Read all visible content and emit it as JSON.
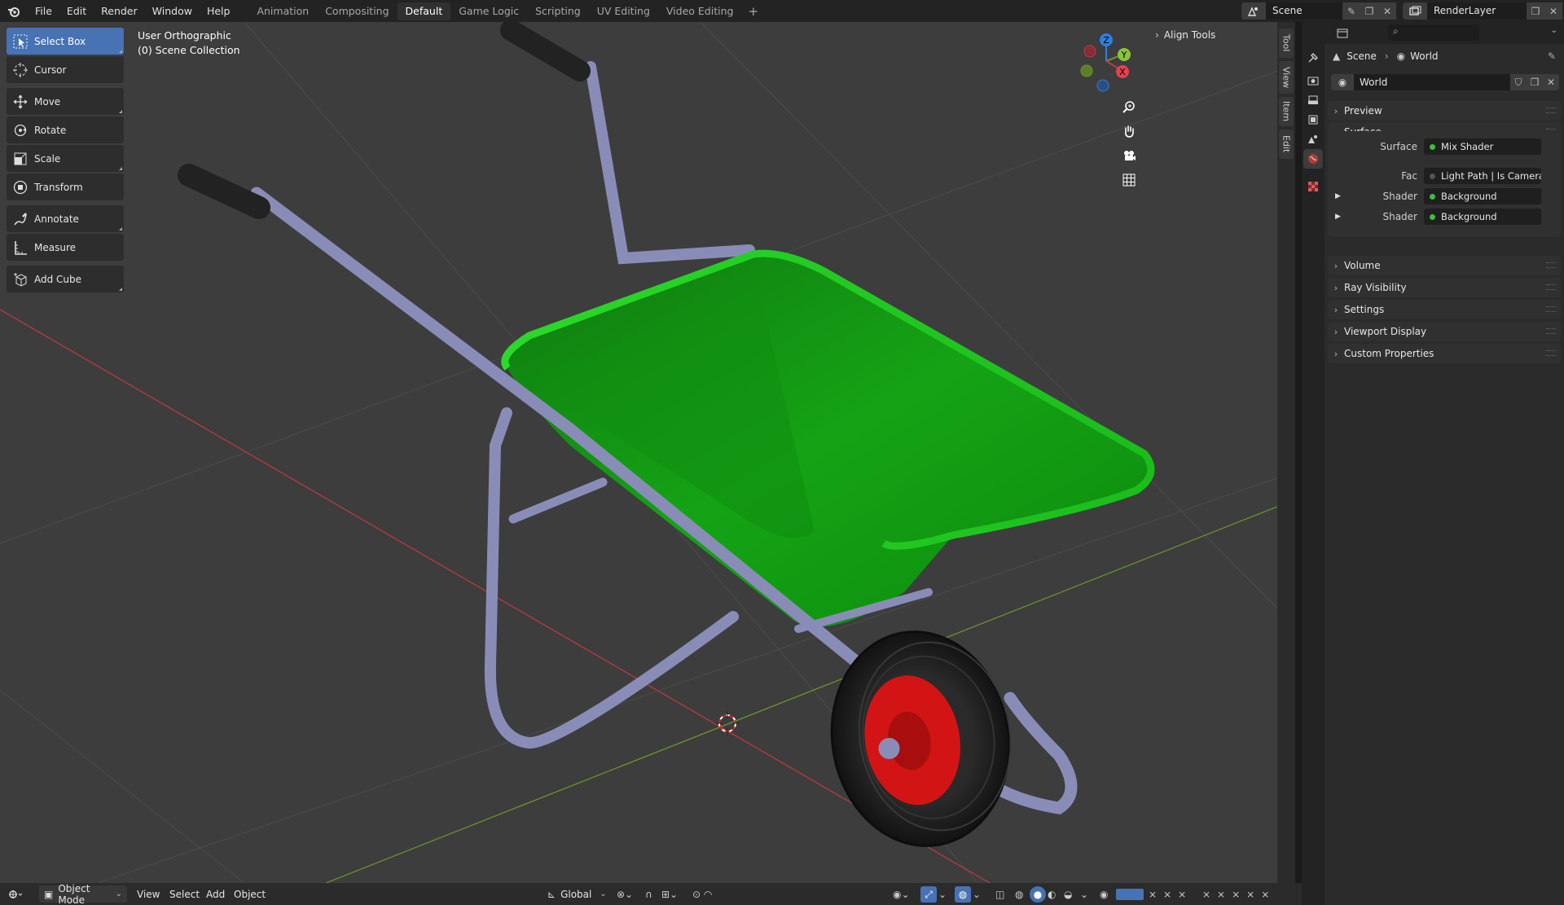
{
  "topbar": {
    "menus": [
      "File",
      "Edit",
      "Render",
      "Window",
      "Help"
    ],
    "workspaces": [
      "Animation",
      "Compositing",
      "Default",
      "Game Logic",
      "Scripting",
      "UV Editing",
      "Video Editing"
    ],
    "active_workspace": "Default",
    "add_tab": "+",
    "scene": "Scene",
    "render_layer": "RenderLayer"
  },
  "viewport": {
    "view_name": "User Orthographic",
    "collection": "(0) Scene Collection",
    "align_tools": "Align Tools",
    "gizmo_axes": {
      "z": "Z",
      "y": "Y",
      "x": "X"
    },
    "colors": {
      "background": "#3d3d3d",
      "x_axis": "#c23a45",
      "y_axis": "#6f9a28",
      "tray": "#1ec21e",
      "frame": "#8a8cb8",
      "hub": "#d31414",
      "tire": "#1f1f1f"
    }
  },
  "toolbar": {
    "tools": [
      {
        "label": "Select Box",
        "icon": "select-box-icon",
        "active": true
      },
      {
        "label": "Cursor",
        "icon": "cursor-icon"
      },
      {
        "label": "Move",
        "icon": "move-icon"
      },
      {
        "label": "Rotate",
        "icon": "rotate-icon"
      },
      {
        "label": "Scale",
        "icon": "scale-icon"
      },
      {
        "label": "Transform",
        "icon": "transform-icon"
      },
      {
        "label": "Annotate",
        "icon": "annotate-icon"
      },
      {
        "label": "Measure",
        "icon": "measure-icon"
      },
      {
        "label": "Add Cube",
        "icon": "add-cube-icon"
      }
    ]
  },
  "side_tabs": [
    "Tool",
    "View",
    "Item",
    "Edit"
  ],
  "properties": {
    "breadcrumb": {
      "scene": "Scene",
      "world": "World"
    },
    "world_name": "World",
    "panels": {
      "preview": "Preview",
      "surface": "Surface",
      "volume": "Volume",
      "ray_visibility": "Ray Visibility",
      "settings": "Settings",
      "viewport_display": "Viewport Display",
      "custom_properties": "Custom Properties"
    },
    "surface_rows": {
      "surface_label": "Surface",
      "surface_value": "Mix Shader",
      "fac_label": "Fac",
      "fac_value": "Light Path | Is Camera ...",
      "shader1_label": "Shader",
      "shader1_value": "Background",
      "shader2_label": "Shader",
      "shader2_value": "Background"
    }
  },
  "bottombar": {
    "mode": "Object Mode",
    "menus": [
      "View",
      "Select",
      "Add",
      "Object"
    ],
    "orientation": "Global"
  }
}
